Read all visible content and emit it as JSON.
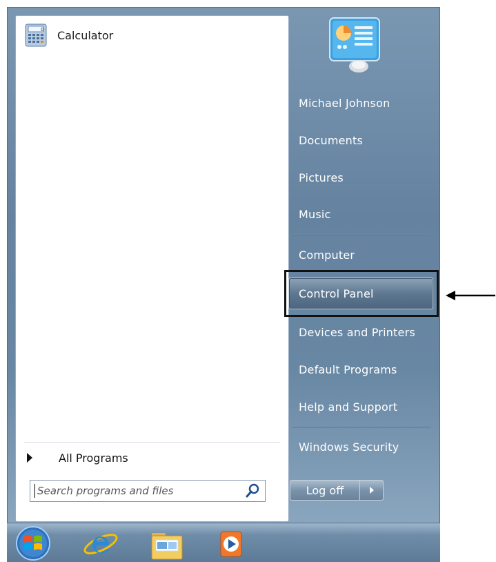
{
  "left_panel": {
    "pinned": [
      {
        "label": "Calculator",
        "icon": "calculator-icon"
      }
    ],
    "all_programs_label": "All Programs",
    "search": {
      "placeholder": "Search programs and files",
      "value": ""
    }
  },
  "right_panel": {
    "items": [
      {
        "label": "Michael Johnson"
      },
      {
        "label": "Documents"
      },
      {
        "label": "Pictures"
      },
      {
        "label": "Music"
      },
      {
        "label": "Computer"
      },
      {
        "label": "Control Panel",
        "highlighted": true
      },
      {
        "label": "Devices and Printers"
      },
      {
        "label": "Default Programs"
      },
      {
        "label": "Help and Support"
      },
      {
        "label": "Windows Security"
      }
    ],
    "logoff_label": "Log off"
  },
  "taskbar": {
    "icons": [
      "windows-start-orb-icon",
      "internet-explorer-icon",
      "windows-explorer-icon",
      "media-player-icon"
    ]
  },
  "annotation": {
    "pointer": "arrow-pointing-left",
    "target": "Control Panel"
  },
  "colors": {
    "menu_bg": "#6a88a5",
    "highlight_border": "#111111",
    "text_right": "#ffffff"
  }
}
